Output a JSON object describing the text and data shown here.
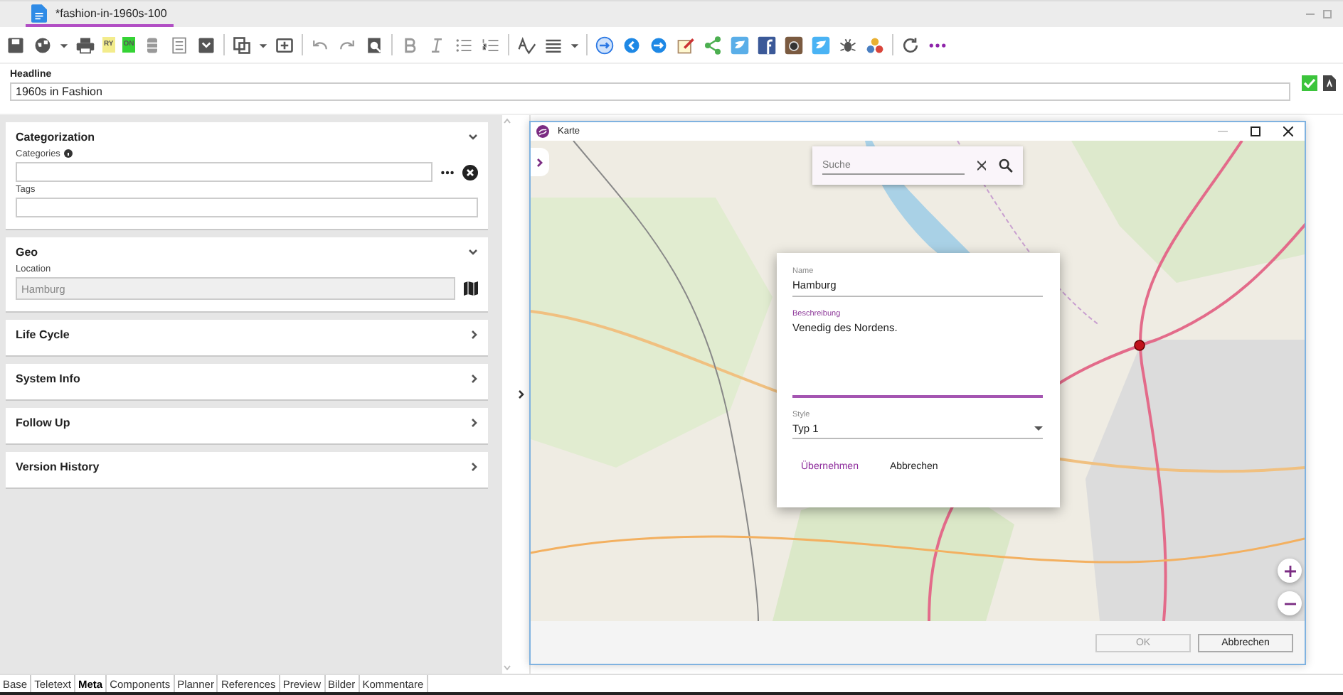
{
  "document_tab": {
    "title": "*fashion-in-1960s-100",
    "selected": true
  },
  "toolbar": {
    "badges": [
      {
        "text": "RY",
        "color": "#f3ec8c"
      },
      {
        "text": "ON",
        "color": "#35d335"
      }
    ]
  },
  "headline": {
    "label": "Headline",
    "value": "1960s in Fashion"
  },
  "panels": [
    {
      "title": "Categorization",
      "expanded": true,
      "fields": [
        {
          "label": "Categories",
          "kind": "picker",
          "info": true
        },
        {
          "label": "Tags",
          "kind": "text"
        }
      ]
    },
    {
      "title": "Geo",
      "expanded": true,
      "fields": [
        {
          "label": "Location",
          "kind": "location",
          "value": "Hamburg",
          "disabled": true
        }
      ]
    },
    {
      "title": "Life Cycle",
      "expanded": false
    },
    {
      "title": "System Info",
      "expanded": false
    },
    {
      "title": "Follow Up",
      "expanded": false
    },
    {
      "title": "Version  History",
      "expanded": false
    }
  ],
  "map_dialog": {
    "title": "Karte",
    "search": {
      "placeholder": "Suche"
    },
    "popup": {
      "name": {
        "label": "Name",
        "value": "Hamburg"
      },
      "description": {
        "label": "Beschreibung",
        "value": "Venedig des Nordens."
      },
      "style": {
        "label": "Style",
        "value": "Typ 1"
      },
      "buttons": [
        {
          "label": "Übernehmen",
          "primary": true
        },
        {
          "label": "Abbrechen",
          "primary": false
        }
      ]
    },
    "footer_buttons": [
      {
        "label": "OK",
        "disabled": true
      },
      {
        "label": "Abbrechen",
        "disabled": false
      }
    ]
  },
  "bottom_tabs": [
    {
      "label": "Base",
      "selected": false
    },
    {
      "label": "Teletext",
      "selected": false
    },
    {
      "label": "Meta",
      "selected": true
    },
    {
      "label": "Components",
      "selected": false
    },
    {
      "label": "Planner",
      "selected": false
    },
    {
      "label": "References",
      "selected": false
    },
    {
      "label": "Preview",
      "selected": false
    },
    {
      "label": "Bilder",
      "selected": false
    },
    {
      "label": "Kommentare",
      "selected": false
    }
  ]
}
